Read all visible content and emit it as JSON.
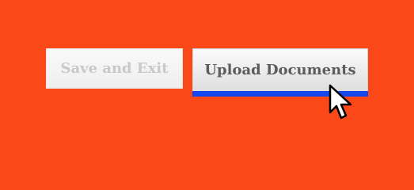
{
  "actions": {
    "save_exit_label": "Save and Exit",
    "upload_label": "Upload Documents"
  },
  "icons": {
    "cursor": "mouse-pointer-icon"
  },
  "colors": {
    "background": "#fb4818",
    "focus_bar": "#1448ee"
  }
}
